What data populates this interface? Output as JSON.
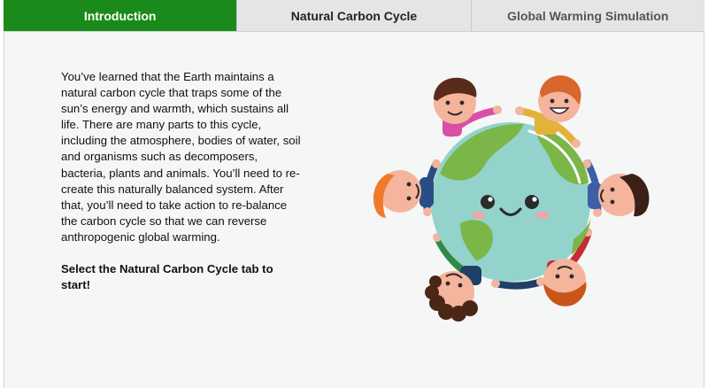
{
  "tabs": [
    {
      "label": "Introduction",
      "active": true
    },
    {
      "label": "Natural Carbon Cycle",
      "active": false
    },
    {
      "label": "Global Warming Simulation",
      "active": false
    }
  ],
  "intro": {
    "paragraph": "You’ve learned that the Earth maintains a natural carbon cycle that traps some of the sun’s energy and warmth, which sustains all life. There are many parts to this cycle, including the atmosphere, bodies of water, soil and organisms such as decomposers, bacteria, plants and animals. You’ll need to re-create this naturally balanced system. After that, you’ll need to take action to re-balance the carbon cycle so that we can reverse anthropogenic global warming.",
    "call_to_action": "Select the Natural Carbon Cycle tab to start!"
  },
  "illustration": {
    "icon": "smiling-earth-with-people-icon",
    "colors": {
      "ocean": "#93d3cc",
      "land": "#7ab648",
      "active_tab": "#1a8a1a"
    }
  }
}
